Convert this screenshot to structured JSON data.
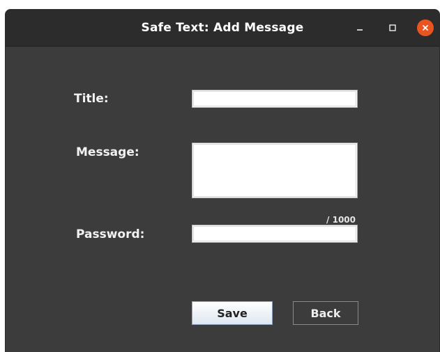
{
  "window": {
    "title": "Safe Text: Add Message"
  },
  "form": {
    "title_label": "Title:",
    "title_value": "",
    "message_label": "Message:",
    "message_value": "",
    "message_counter": "/ 1000",
    "password_label": "Password:",
    "password_value": ""
  },
  "buttons": {
    "save_label": "Save",
    "back_label": "Back"
  },
  "icons": {
    "minimize": "minimize-icon",
    "maximize": "maximize-icon",
    "close": "close-icon"
  },
  "colors": {
    "close_button": "#e95420",
    "window_background": "#3c3c3c",
    "titlebar_background": "#2c2c2c"
  }
}
